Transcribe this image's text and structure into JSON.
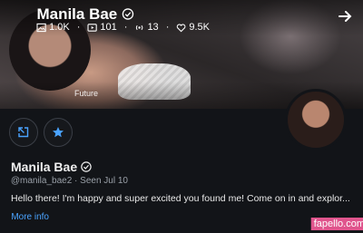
{
  "header": {
    "name": "Manila Bae",
    "stats": {
      "photos": "1.0K",
      "videos": "101",
      "streams": "13",
      "likes": "9.5K"
    }
  },
  "banner": {
    "watermark": "Future"
  },
  "profile": {
    "name": "Manila Bae",
    "handle": "@manila_bae2",
    "separator": "·",
    "last_seen": "Seen  Jul 10",
    "bio": "Hello there! I'm happy and super excited you found me! Come on in and explor...",
    "more_info": "More info"
  },
  "site_badge": "fapello.com",
  "colors": {
    "accent": "#4aa3ff",
    "badge": "#e0558d",
    "background": "#121418"
  }
}
